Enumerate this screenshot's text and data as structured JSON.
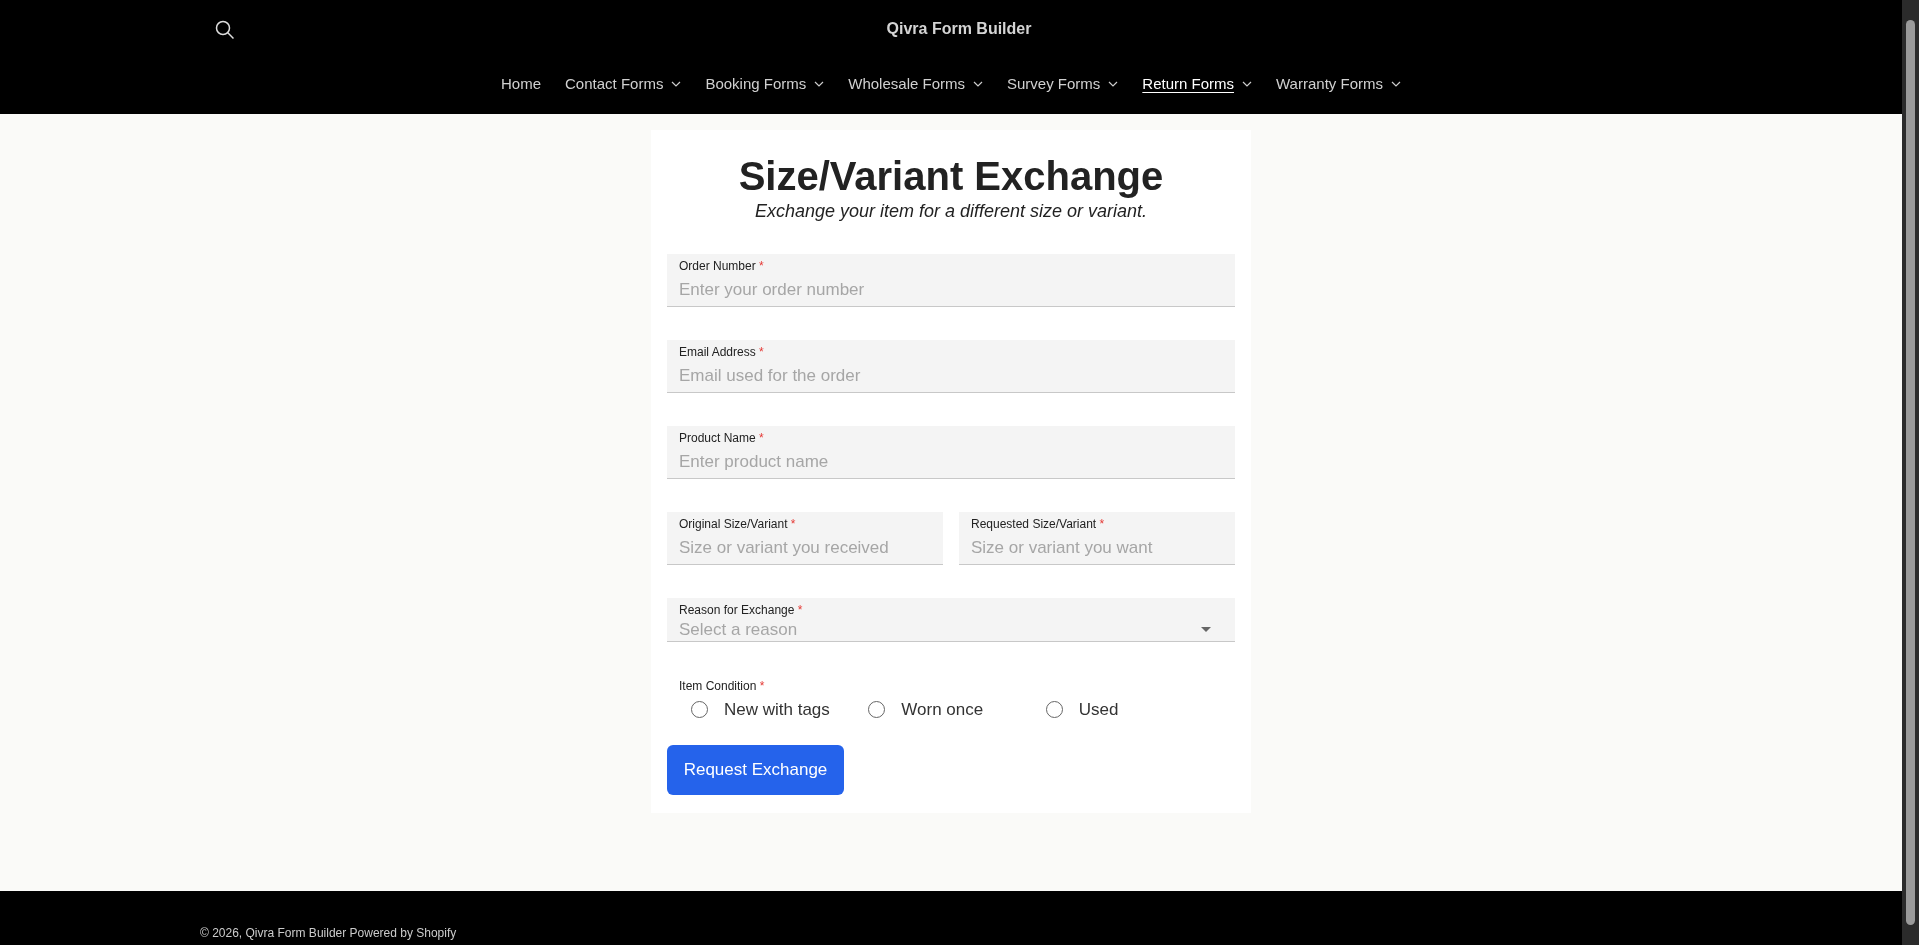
{
  "header": {
    "title": "Qivra Form Builder",
    "nav": [
      {
        "label": "Home",
        "has_dropdown": false,
        "selected": false
      },
      {
        "label": "Contact Forms",
        "has_dropdown": true,
        "selected": false
      },
      {
        "label": "Booking Forms",
        "has_dropdown": true,
        "selected": false
      },
      {
        "label": "Wholesale Forms",
        "has_dropdown": true,
        "selected": false
      },
      {
        "label": "Survey Forms",
        "has_dropdown": true,
        "selected": false
      },
      {
        "label": "Return Forms",
        "has_dropdown": true,
        "selected": true
      },
      {
        "label": "Warranty Forms",
        "has_dropdown": true,
        "selected": false
      }
    ]
  },
  "form": {
    "title": "Size/Variant Exchange",
    "subtitle": "Exchange your item for a different size or variant.",
    "rows": [
      {
        "fields": [
          {
            "kind": "text",
            "label": "Order Number",
            "required_mark": "*",
            "placeholder": "Enter your order number"
          }
        ]
      },
      {
        "fields": [
          {
            "kind": "text",
            "label": "Email Address",
            "required_mark": "*",
            "placeholder": "Email used for the order"
          }
        ]
      },
      {
        "fields": [
          {
            "kind": "text",
            "label": "Product Name",
            "required_mark": "*",
            "placeholder": "Enter product name"
          }
        ]
      },
      {
        "fields": [
          {
            "kind": "text",
            "label": "Original Size/Variant",
            "required_mark": "*",
            "placeholder": "Size or variant you received"
          },
          {
            "kind": "text",
            "label": "Requested Size/Variant",
            "required_mark": "*",
            "placeholder": "Size or variant you want"
          }
        ]
      },
      {
        "fields": [
          {
            "kind": "select",
            "label": "Reason for Exchange",
            "required_mark": "*",
            "placeholder": "Select a reason"
          }
        ]
      },
      {
        "fields": [
          {
            "kind": "radio",
            "label": "Item Condition",
            "required_mark": "*",
            "options": [
              {
                "label": "New with tags",
                "selected": false
              },
              {
                "label": "Worn once",
                "selected": false
              },
              {
                "label": "Used",
                "selected": false
              }
            ]
          }
        ]
      }
    ],
    "submit": "Request Exchange"
  },
  "footer": {
    "text": "© 2026, Qivra Form Builder Powered by Shopify"
  }
}
